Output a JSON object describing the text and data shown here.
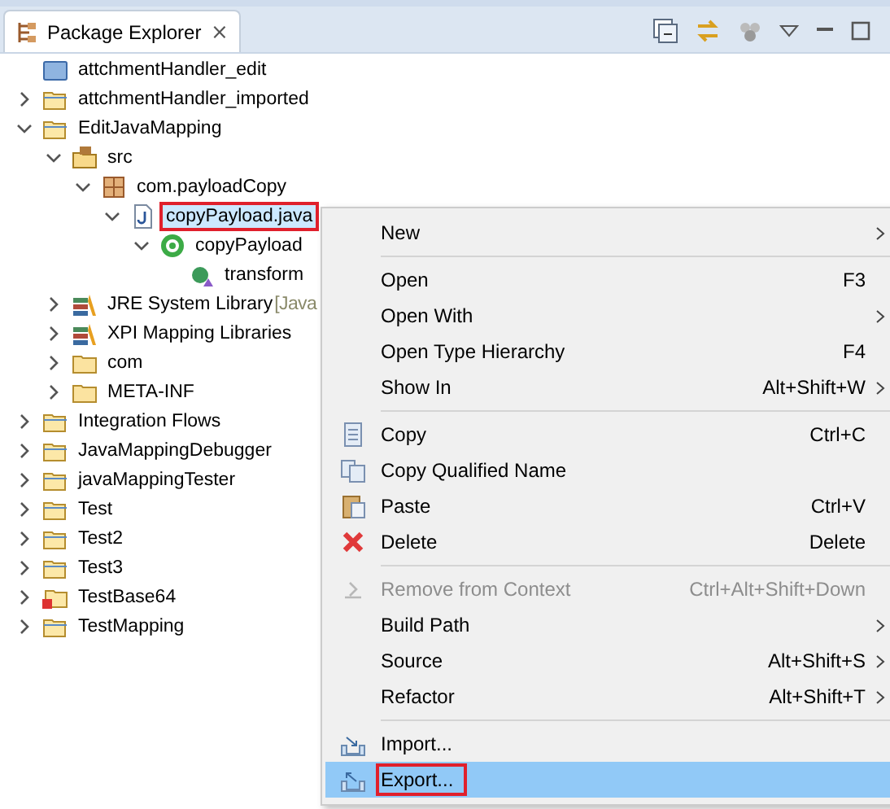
{
  "view": {
    "title": "Package Explorer",
    "close": "⨯"
  },
  "tree": [
    {
      "label": "attchmentHandler_edit",
      "kind": "closed-project",
      "selected": false,
      "outlined": false
    },
    {
      "label": "attchmentHandler_imported",
      "kind": "project",
      "expanded": false,
      "selected": false,
      "outlined": false
    },
    {
      "label": "EditJavaMapping",
      "kind": "project",
      "expanded": true,
      "selected": false,
      "outlined": false,
      "children": [
        {
          "label": "src",
          "kind": "source-folder",
          "expanded": true,
          "selected": false,
          "outlined": false,
          "children": [
            {
              "label": "com.payloadCopy",
              "kind": "package",
              "expanded": true,
              "selected": false,
              "outlined": false,
              "children": [
                {
                  "label": "copyPayload.java",
                  "kind": "java-file",
                  "expanded": true,
                  "selected": true,
                  "outlined": true,
                  "children": [
                    {
                      "label": "copyPayload",
                      "kind": "class",
                      "expanded": true,
                      "selected": false,
                      "outlined": false,
                      "children": [
                        {
                          "label": "transform",
                          "kind": "method",
                          "selected": false,
                          "outlined": false
                        }
                      ]
                    }
                  ]
                }
              ]
            }
          ]
        },
        {
          "label": "JRE System Library",
          "note": "[Java",
          "kind": "library",
          "expanded": false,
          "selected": false,
          "outlined": false
        },
        {
          "label": "XPI Mapping Libraries",
          "kind": "library",
          "expanded": false,
          "selected": false,
          "outlined": false
        },
        {
          "label": "com",
          "kind": "folder",
          "expanded": false,
          "selected": false,
          "outlined": false
        },
        {
          "label": "META-INF",
          "kind": "folder",
          "expanded": false,
          "selected": false,
          "outlined": false
        }
      ]
    },
    {
      "label": "Integration Flows",
      "kind": "project",
      "expanded": false,
      "selected": false,
      "outlined": false
    },
    {
      "label": "JavaMappingDebugger",
      "kind": "project",
      "expanded": false,
      "selected": false,
      "outlined": false
    },
    {
      "label": "javaMappingTester",
      "kind": "project",
      "expanded": false,
      "selected": false,
      "outlined": false
    },
    {
      "label": "Test",
      "kind": "project",
      "expanded": false,
      "selected": false,
      "outlined": false
    },
    {
      "label": "Test2",
      "kind": "project",
      "expanded": false,
      "selected": false,
      "outlined": false
    },
    {
      "label": "Test3",
      "kind": "project",
      "expanded": false,
      "selected": false,
      "outlined": false
    },
    {
      "label": "TestBase64",
      "kind": "error-project",
      "expanded": false,
      "selected": false,
      "outlined": false
    },
    {
      "label": "TestMapping",
      "kind": "project",
      "expanded": false,
      "selected": false,
      "outlined": false
    }
  ],
  "context_menu": {
    "groups": [
      [
        {
          "label": "New",
          "submenu": true,
          "kind": "plain",
          "disabled": false,
          "selected": false,
          "outlined": false
        }
      ],
      [
        {
          "label": "Open",
          "shortcut": "F3",
          "kind": "plain",
          "disabled": false,
          "selected": false,
          "outlined": false
        },
        {
          "label": "Open With",
          "submenu": true,
          "kind": "plain",
          "disabled": false,
          "selected": false,
          "outlined": false
        },
        {
          "label": "Open Type Hierarchy",
          "shortcut": "F4",
          "kind": "plain",
          "disabled": false,
          "selected": false,
          "outlined": false
        },
        {
          "label": "Show In",
          "shortcut": "Alt+Shift+W",
          "submenu": true,
          "kind": "plain",
          "disabled": false,
          "selected": false,
          "outlined": false
        }
      ],
      [
        {
          "label": "Copy",
          "shortcut": "Ctrl+C",
          "kind": "copy",
          "disabled": false,
          "selected": false,
          "outlined": false
        },
        {
          "label": "Copy Qualified Name",
          "kind": "copy-name",
          "disabled": false,
          "selected": false,
          "outlined": false
        },
        {
          "label": "Paste",
          "shortcut": "Ctrl+V",
          "kind": "paste",
          "disabled": false,
          "selected": false,
          "outlined": false
        },
        {
          "label": "Delete",
          "shortcut": "Delete",
          "kind": "delete",
          "disabled": false,
          "selected": false,
          "outlined": false
        }
      ],
      [
        {
          "label": "Remove from Context",
          "shortcut": "Ctrl+Alt+Shift+Down",
          "kind": "remove",
          "disabled": true,
          "selected": false,
          "outlined": false
        },
        {
          "label": "Build Path",
          "submenu": true,
          "kind": "plain",
          "disabled": false,
          "selected": false,
          "outlined": false
        },
        {
          "label": "Source",
          "shortcut": "Alt+Shift+S",
          "submenu": true,
          "kind": "plain",
          "disabled": false,
          "selected": false,
          "outlined": false
        },
        {
          "label": "Refactor",
          "shortcut": "Alt+Shift+T",
          "submenu": true,
          "kind": "plain",
          "disabled": false,
          "selected": false,
          "outlined": false
        }
      ],
      [
        {
          "label": "Import...",
          "kind": "import",
          "disabled": false,
          "selected": false,
          "outlined": false
        },
        {
          "label": "Export...",
          "kind": "export",
          "disabled": false,
          "selected": true,
          "outlined": true
        }
      ]
    ]
  }
}
